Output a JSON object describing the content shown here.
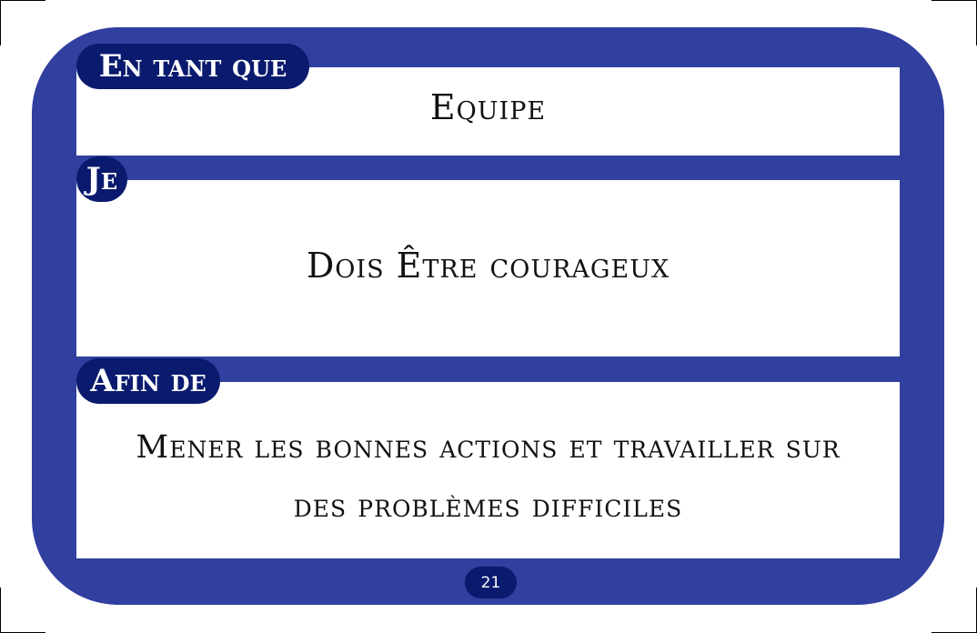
{
  "card": {
    "colors": {
      "frame": "#313f9e",
      "tag": "#0a1a6e",
      "panel": "#ffffff",
      "text": "#111111"
    },
    "sections": {
      "role": {
        "tag": "En tant que",
        "text": "Equipe"
      },
      "need": {
        "tag": "Je",
        "text": "Dois Être courageux"
      },
      "goal": {
        "tag": "Afin de",
        "line1": "Mener les bonnes actions et travailler sur",
        "line2": "des problèmes difficiles"
      }
    },
    "page_number": "21"
  }
}
